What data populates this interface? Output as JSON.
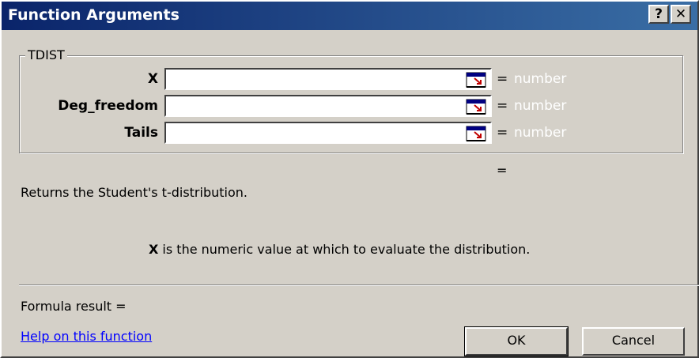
{
  "window": {
    "title": "Function Arguments",
    "help_glyph": "?",
    "close_glyph": "✕"
  },
  "group": {
    "label": "TDIST"
  },
  "arguments": [
    {
      "label": "X",
      "value": "",
      "equals": "=",
      "result": "number"
    },
    {
      "label": "Deg_freedom",
      "value": "",
      "equals": "=",
      "result": "number"
    },
    {
      "label": "Tails",
      "value": "",
      "equals": "=",
      "result": "number"
    }
  ],
  "function_result_equals": "=",
  "description": "Returns the Student's t-distribution.",
  "arg_help": {
    "name": "X",
    "text": " is the numeric value at which to evaluate the distribution."
  },
  "formula_result_label": "Formula result =",
  "help_link": "Help on this function",
  "buttons": {
    "ok": "OK",
    "cancel": "Cancel"
  },
  "icons": {
    "collapse_dialog": "collapse-dialog-icon"
  }
}
